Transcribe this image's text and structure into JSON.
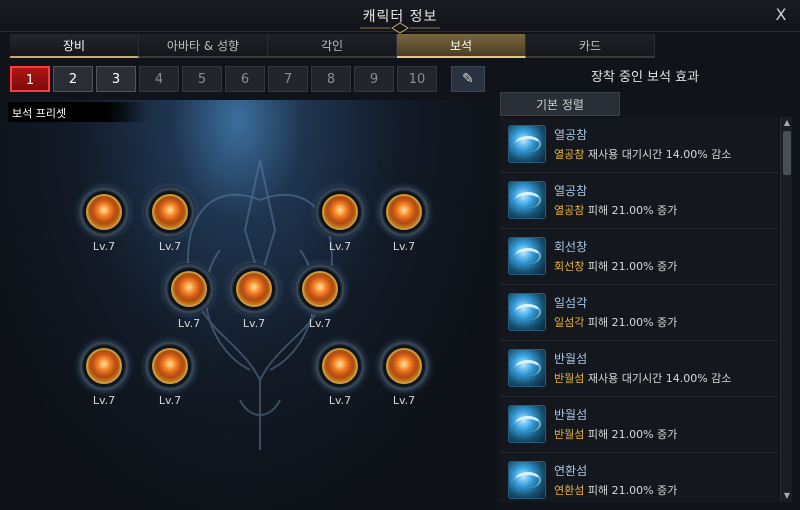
{
  "window": {
    "title": "캐릭터 정보",
    "close_label": "X"
  },
  "tabs": [
    {
      "label": "장비",
      "state": "active-dark"
    },
    {
      "label": "아바타 & 성향",
      "state": ""
    },
    {
      "label": "각인",
      "state": ""
    },
    {
      "label": "보석",
      "state": "active-gold"
    },
    {
      "label": "카드",
      "state": ""
    }
  ],
  "presets": [
    "1",
    "2",
    "3",
    "4",
    "5",
    "6",
    "7",
    "8",
    "9",
    "10"
  ],
  "preset_selected": "1",
  "preset_label": "보석 프리셋",
  "gems": [
    {
      "level": "Lv.7"
    },
    {
      "level": "Lv.7"
    },
    {
      "level": "Lv.7"
    },
    {
      "level": "Lv.7"
    },
    {
      "level": "Lv.7"
    },
    {
      "level": "Lv.7"
    },
    {
      "level": "Lv.7"
    },
    {
      "level": "Lv.7"
    },
    {
      "level": "Lv.7"
    },
    {
      "level": "Lv.7"
    },
    {
      "level": "Lv.7"
    }
  ],
  "effects_panel": {
    "title": "장착 중인 보석 효과",
    "sort_label": "기본 정렬",
    "items": [
      {
        "name": "열공참",
        "skill": "열공참",
        "text": " 재사용 대기시간 14.00% 감소"
      },
      {
        "name": "열공참",
        "skill": "열공참",
        "text": " 피해 21.00% 증가"
      },
      {
        "name": "회선창",
        "skill": "회선창",
        "text": " 피해 21.00% 증가"
      },
      {
        "name": "일섬각",
        "skill": "일섬각",
        "text": " 피해 21.00% 증가"
      },
      {
        "name": "반월섬",
        "skill": "반월섬",
        "text": " 재사용 대기시간 14.00% 감소"
      },
      {
        "name": "반월섬",
        "skill": "반월섬",
        "text": " 피해 21.00% 증가"
      },
      {
        "name": "연환섬",
        "skill": "연환섬",
        "text": " 피해 21.00% 증가"
      }
    ]
  },
  "colors": {
    "accent_gold": "#e8c77e",
    "selected_red": "#ff3a3a",
    "skill_name": "#e8b43a"
  }
}
